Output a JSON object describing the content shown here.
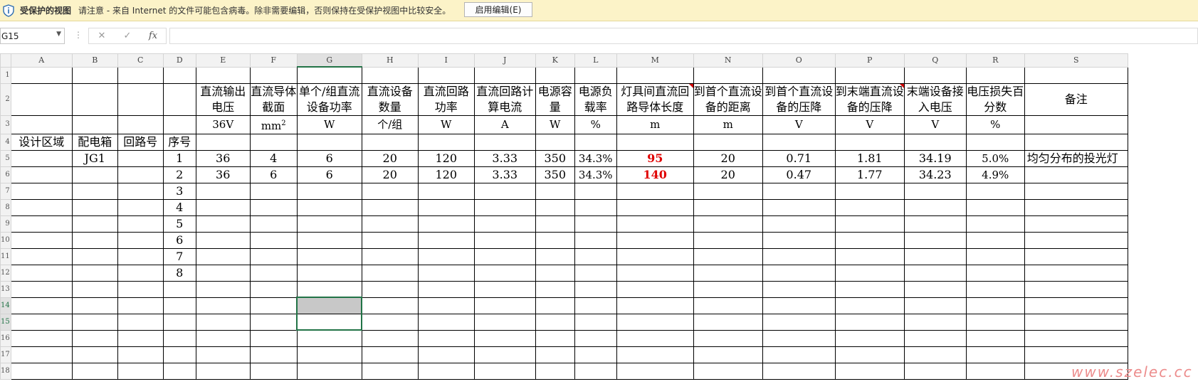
{
  "protected_view": {
    "title": "受保护的视图",
    "message": "请注意 - 来自 Internet 的文件可能包含病毒。除非需要编辑，否则保持在受保护视图中比较安全。",
    "enable_button": "启用编辑(E)"
  },
  "formula_bar": {
    "name_box": "G15",
    "formula": "",
    "cancel_icon": "✕",
    "enter_icon": "✓",
    "fx_label": "fx"
  },
  "columns": [
    "A",
    "B",
    "C",
    "D",
    "E",
    "F",
    "G",
    "H",
    "I",
    "J",
    "K",
    "L",
    "M",
    "N",
    "O",
    "P",
    "Q",
    "R",
    "S"
  ],
  "row_numbers": [
    "1",
    "2",
    "3",
    "4",
    "5",
    "6",
    "7",
    "8",
    "9",
    "10",
    "11",
    "12",
    "13",
    "14",
    "15",
    "16",
    "17",
    "18"
  ],
  "header_row2": {
    "E": "直流输出电压",
    "F": "直流导体截面",
    "G": "单个/组直流设备功率",
    "H": "直流设备数量",
    "I": "直流回路功率",
    "J": "直流回路计算电流",
    "K": "电源容量",
    "L": "电源负载率",
    "M": "灯具间直流回路导体长度",
    "N": "到首个直流设备的距离",
    "O": "到首个直流设备的压降",
    "P": "到末端直流设备的压降",
    "Q": "末端设备接入电压",
    "R": "电压损失百分数",
    "S": "备注"
  },
  "units_row3": {
    "E": "36V",
    "F": "mm",
    "F_sup": "2",
    "G": "W",
    "H": "个/组",
    "I": "W",
    "J": "A",
    "K": "W",
    "L": "%",
    "M": "m",
    "N": "m",
    "O": "V",
    "P": "V",
    "Q": "V",
    "R": "%"
  },
  "labels_row4": {
    "A": "设计区域",
    "B": "配电箱",
    "C": "回路号",
    "D": "序号"
  },
  "data_rows": [
    {
      "A": "",
      "B": "JG1",
      "C": "",
      "D": "1",
      "E": "36",
      "F": "4",
      "G": "6",
      "H": "20",
      "I": "120",
      "J": "3.33",
      "K": "350",
      "L": "34.3%",
      "M": "95",
      "N": "20",
      "O": "0.71",
      "P": "1.81",
      "Q": "34.19",
      "R": "5.0%",
      "S": "均匀分布的投光灯"
    },
    {
      "A": "",
      "B": "",
      "C": "",
      "D": "2",
      "E": "36",
      "F": "6",
      "G": "6",
      "H": "20",
      "I": "120",
      "J": "3.33",
      "K": "350",
      "L": "34.3%",
      "M": "140",
      "N": "20",
      "O": "0.47",
      "P": "1.77",
      "Q": "34.23",
      "R": "4.9%",
      "S": ""
    }
  ],
  "seq_numbers": [
    "3",
    "4",
    "5",
    "6",
    "7",
    "8"
  ],
  "watermark": "www.szelec.cc",
  "colors": {
    "accent": "#217346",
    "red_value": "#e00000",
    "protected_bar": "#fcf3c8"
  }
}
